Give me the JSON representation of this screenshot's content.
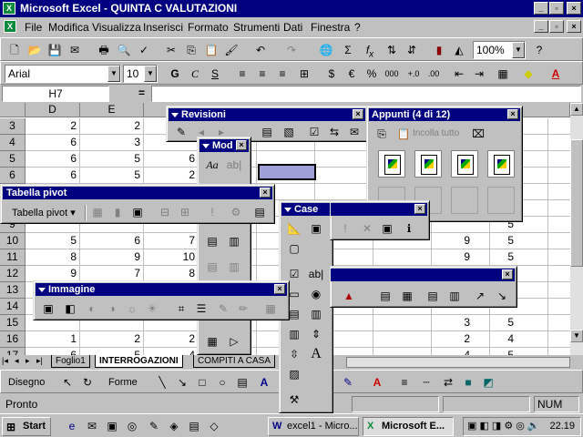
{
  "window": {
    "title": "Microsoft Excel - QUINTA C VALUTAZIONI"
  },
  "menu": [
    "File",
    "Modifica",
    "Visualizza",
    "Inserisci",
    "Formato",
    "Strumenti",
    "Dati",
    "Finestra",
    "?"
  ],
  "toolbar": {
    "zoom": "100%"
  },
  "format": {
    "font": "Arial",
    "size": "10"
  },
  "formula": {
    "namebox": "H7",
    "equals": "="
  },
  "columns": [
    "D",
    "E"
  ],
  "rows": [
    {
      "n": "3",
      "d": "2",
      "e": "2"
    },
    {
      "n": "4",
      "d": "6",
      "e": "3"
    },
    {
      "n": "5",
      "d": "6",
      "e": "5",
      "f": "6"
    },
    {
      "n": "6",
      "d": "6",
      "e": "5",
      "f": "2"
    },
    {
      "n": "7",
      "d": "",
      "e": ""
    },
    {
      "n": "8",
      "d": "",
      "e": ""
    },
    {
      "n": "9",
      "d": "",
      "e": ""
    },
    {
      "n": "10",
      "d": "5",
      "e": "6",
      "f": "7"
    },
    {
      "n": "11",
      "d": "8",
      "e": "9",
      "f": "10"
    },
    {
      "n": "12",
      "d": "9",
      "e": "7",
      "f": "8"
    },
    {
      "n": "13",
      "d": "",
      "e": ""
    },
    {
      "n": "14",
      "d": "",
      "e": ""
    },
    {
      "n": "15",
      "d": "",
      "e": ""
    },
    {
      "n": "16",
      "d": "1",
      "e": "2",
      "f": "2"
    },
    {
      "n": "17",
      "d": "6",
      "e": "5",
      "f": "4"
    }
  ],
  "right_cells": [
    {
      "row": "10",
      "a": "9",
      "b": "5"
    },
    {
      "row": "11",
      "a": "9",
      "b": "5"
    },
    {
      "row": "15",
      "a": "3",
      "b": "5"
    },
    {
      "row": "16",
      "a": "2",
      "b": "4"
    },
    {
      "row": "17",
      "a": "4",
      "b": "5"
    },
    {
      "row": "9",
      "b": "5"
    },
    {
      "row": "12",
      "b": "5"
    }
  ],
  "sheets": [
    "Foglio1",
    "INTERROGAZIONI",
    "COMPITI A CASA"
  ],
  "drawing": {
    "draw": "Disegno",
    "shapes": "Forme"
  },
  "status": {
    "text": "Pronto",
    "num": "NUM"
  },
  "taskbar": {
    "start": "Start",
    "task1": "excel1 - Micro...",
    "task2": "Microsoft E...",
    "clock": "22.19"
  },
  "palettes": {
    "revisioni": "Revisioni",
    "modulo": "Mod",
    "appunti": "Appunti (4 di 12)",
    "incolla": "Incolla tutto",
    "pivot": "Tabella pivot",
    "pivot_menu": "Tabella pivot",
    "immagine": "Immagine",
    "casella": "Case"
  }
}
